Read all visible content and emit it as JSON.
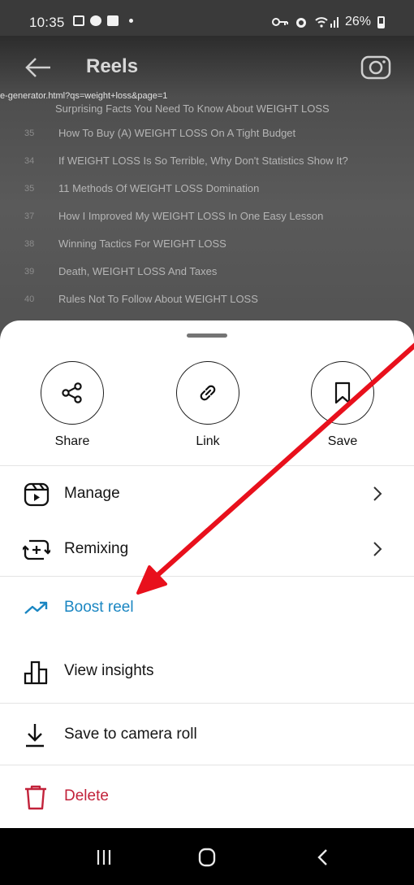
{
  "status_bar": {
    "time": "10:35",
    "battery": "26%"
  },
  "reel": {
    "title": "Reels",
    "url": "e-generator.html?qs=weight+loss&page=1",
    "photo_rows": [
      {
        "num": "",
        "text": "Surprising Facts You Need To Know About WEIGHT LOSS"
      },
      {
        "num": "35",
        "text": "How To Buy (A) WEIGHT LOSS On A Tight Budget"
      },
      {
        "num": "34",
        "text": "If WEIGHT LOSS Is So Terrible, Why Don't Statistics Show It?"
      },
      {
        "num": "35",
        "text": "11 Methods Of WEIGHT LOSS Domination"
      },
      {
        "num": "37",
        "text": "How I Improved My WEIGHT LOSS In One Easy Lesson"
      },
      {
        "num": "38",
        "text": "Winning Tactics For WEIGHT LOSS"
      },
      {
        "num": "39",
        "text": "Death, WEIGHT LOSS And Taxes"
      },
      {
        "num": "40",
        "text": "Rules Not To Follow About WEIGHT LOSS"
      }
    ]
  },
  "sheet": {
    "actions": [
      {
        "label": "Share",
        "icon": "share-icon"
      },
      {
        "label": "Link",
        "icon": "link-icon"
      },
      {
        "label": "Save",
        "icon": "bookmark-icon"
      }
    ],
    "items": [
      {
        "label": "Manage",
        "icon": "reel-play-icon",
        "has_chevron": true
      },
      {
        "label": "Remixing",
        "icon": "remix-icon",
        "has_chevron": true
      },
      {
        "label": "Boost reel",
        "icon": "trending-up-icon",
        "color": "#1a86c2"
      },
      {
        "label": "View insights",
        "icon": "bar-chart-icon"
      },
      {
        "label": "Save to camera roll",
        "icon": "download-icon"
      },
      {
        "label": "Delete",
        "icon": "trash-icon",
        "color": "#c2223a"
      }
    ]
  },
  "colors": {
    "accent_blue": "#1a86c2",
    "danger_red": "#c2223a",
    "annotation_arrow": "#e8101c"
  }
}
